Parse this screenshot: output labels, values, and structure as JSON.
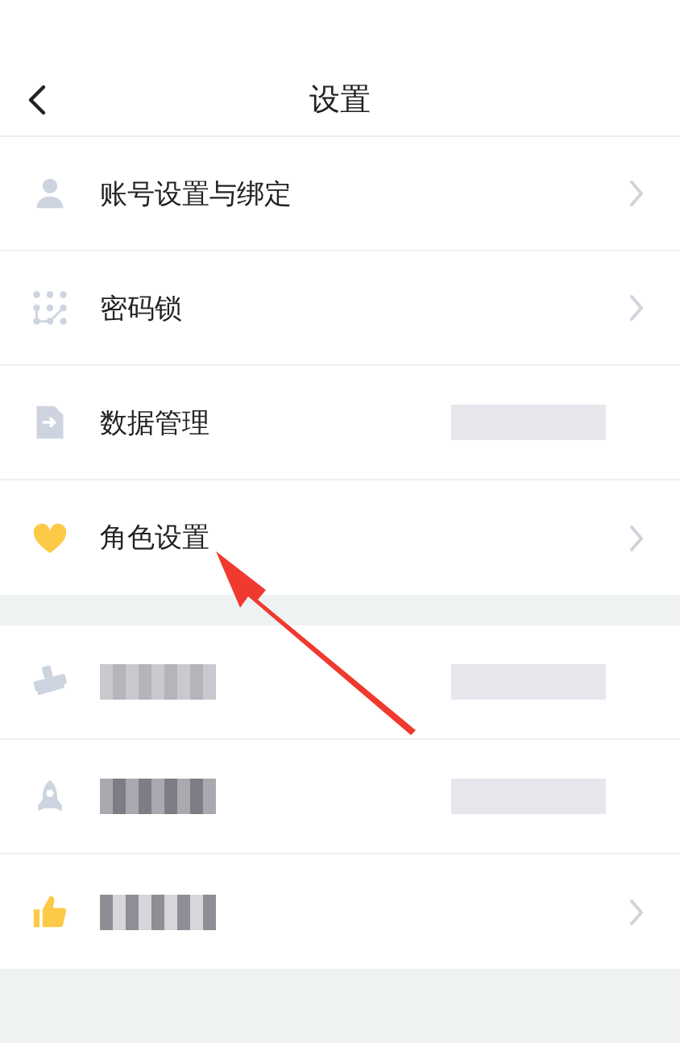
{
  "header": {
    "title": "设置"
  },
  "groups": [
    {
      "rows": [
        {
          "kind": "person",
          "label": "账号设置与绑定",
          "label_redacted": false,
          "value_redacted": false,
          "chevron": true
        },
        {
          "kind": "dots",
          "label": "密码锁",
          "label_redacted": false,
          "value_redacted": false,
          "chevron": true
        },
        {
          "kind": "file",
          "label": "数据管理",
          "label_redacted": false,
          "value_redacted": true,
          "chevron": false
        },
        {
          "kind": "heart",
          "label": "角色设置",
          "label_redacted": false,
          "value_redacted": false,
          "chevron": true
        }
      ]
    },
    {
      "rows": [
        {
          "kind": "brush",
          "label_redacted": true,
          "value_redacted": true,
          "chevron": false
        },
        {
          "kind": "rocket",
          "label_redacted": true,
          "value_redacted": true,
          "chevron": false
        },
        {
          "kind": "thumb",
          "label_redacted": true,
          "value_redacted": false,
          "chevron": true
        }
      ]
    }
  ],
  "annotation_arrow": true
}
